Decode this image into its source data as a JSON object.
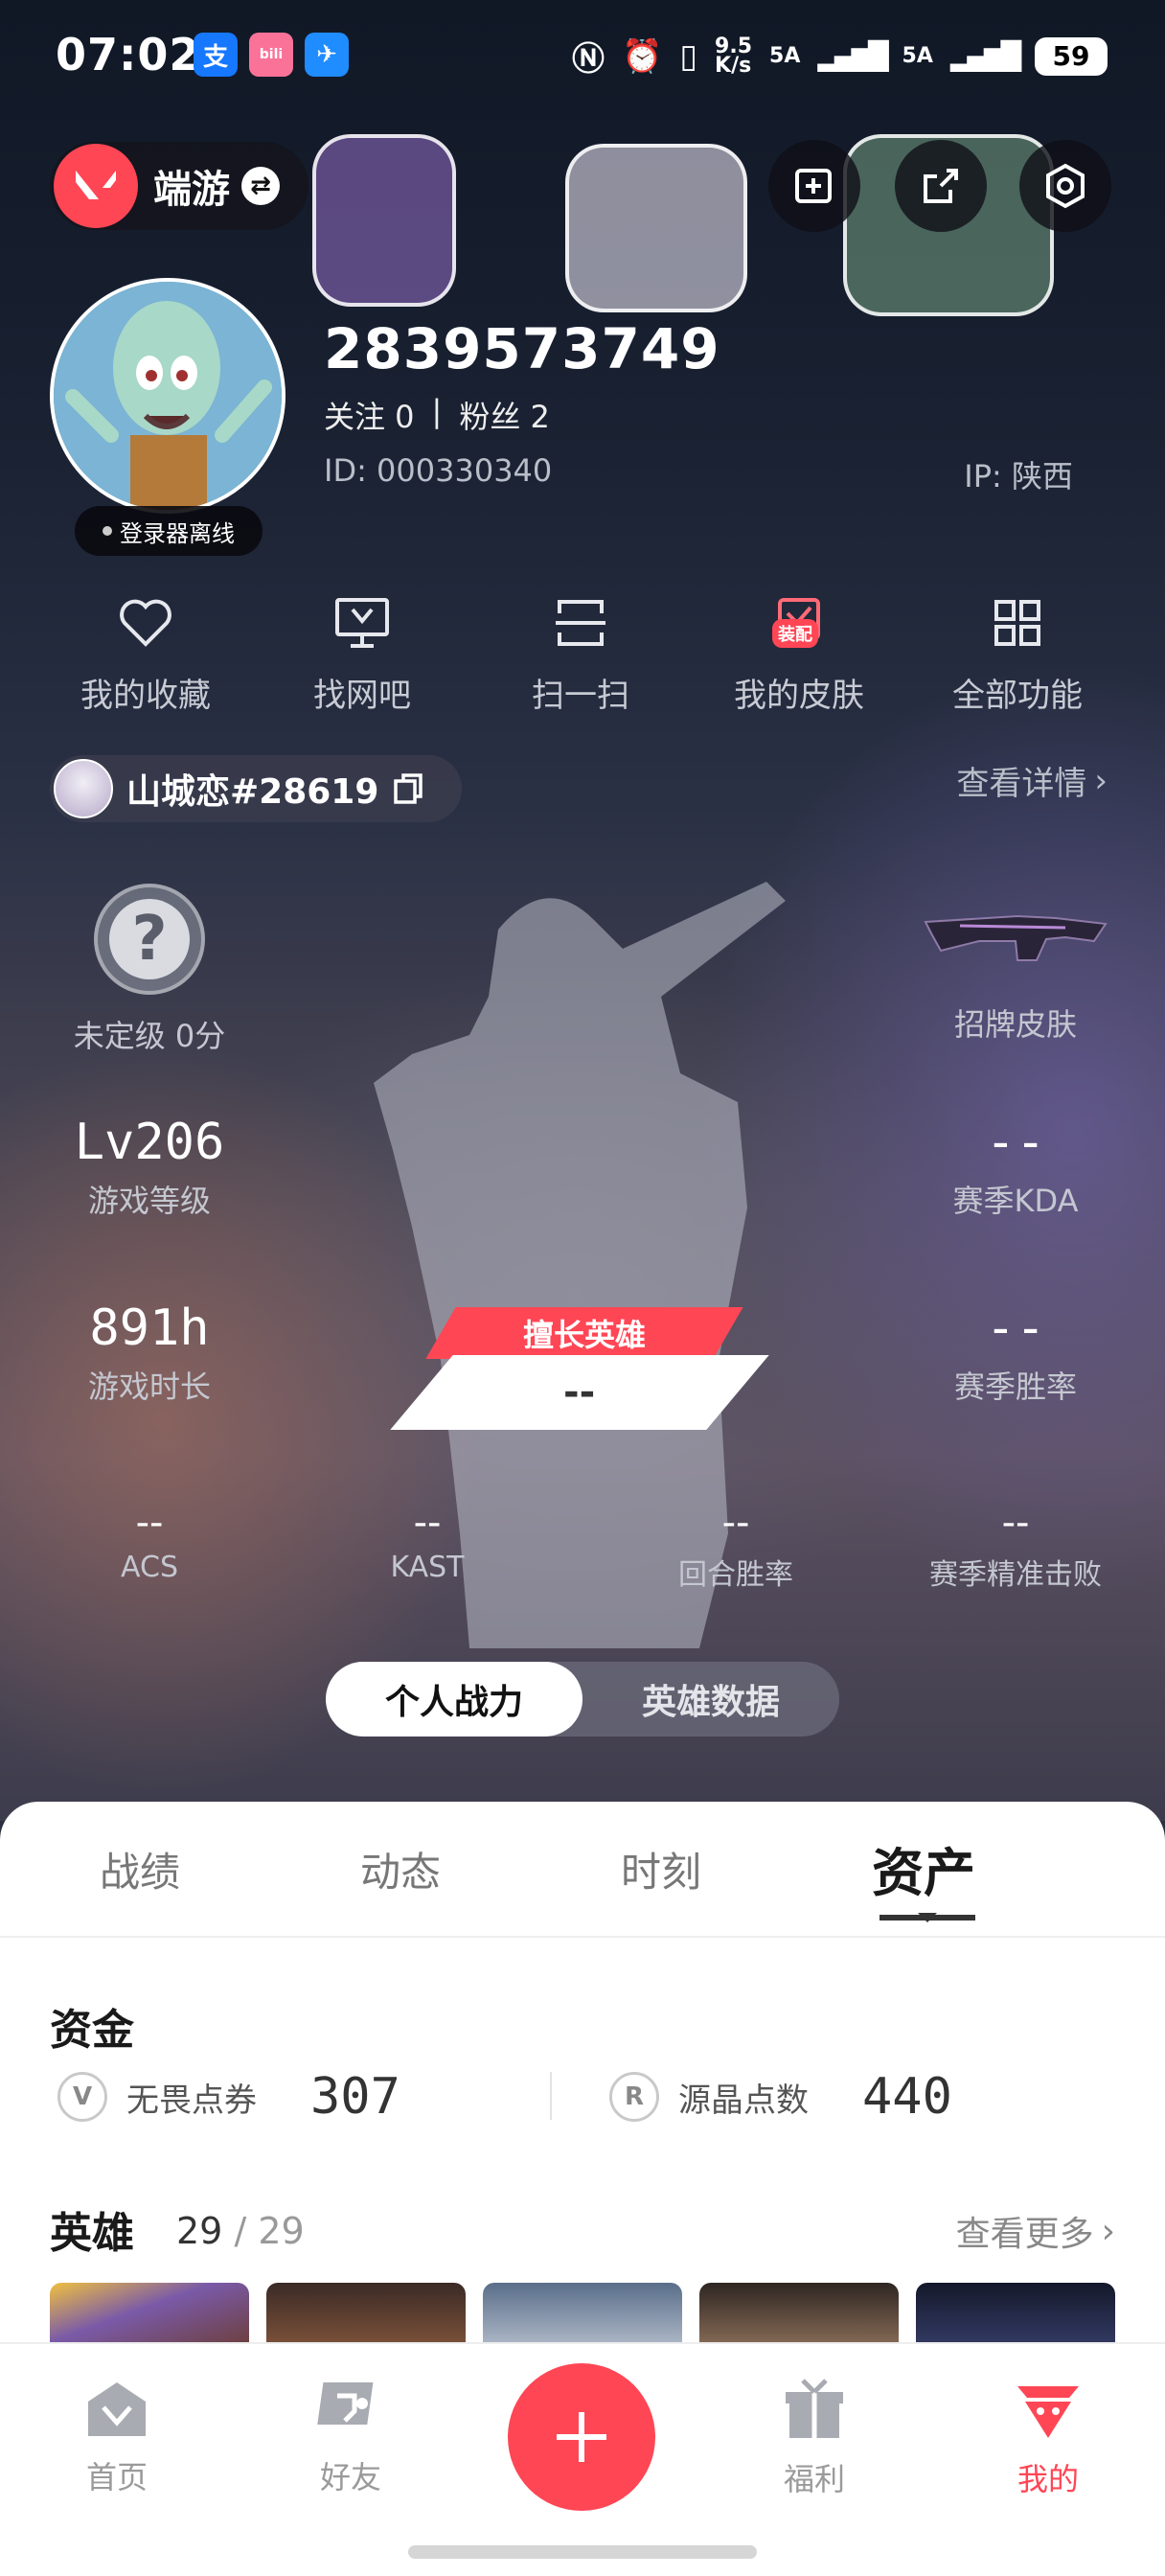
{
  "status_bar": {
    "time": "07:02",
    "app_badges": [
      "支",
      "bili",
      "✈"
    ],
    "net_speed_top": "9.5",
    "net_speed_unit": "K/s",
    "signal_1": "5A",
    "signal_2": "5A",
    "battery": "59"
  },
  "header": {
    "game_name": "端游",
    "icons": [
      "share-screen-icon",
      "share-icon",
      "settings-icon"
    ]
  },
  "profile": {
    "username": "2839573749",
    "follow_label": "关注 0",
    "fans_label": "粉丝 2",
    "separator": "|",
    "id_text": "ID:  000330340",
    "ip_text": "IP:  陕西",
    "status": "登录器离线"
  },
  "quick_actions": [
    {
      "label": "我的收藏",
      "icon": "heart-icon"
    },
    {
      "label": "找网吧",
      "icon": "monitor-icon"
    },
    {
      "label": "扫一扫",
      "icon": "scan-icon"
    },
    {
      "label": "我的皮肤",
      "icon": "skin-icon",
      "badge": "装配"
    },
    {
      "label": "全部功能",
      "icon": "grid-icon"
    }
  ],
  "riot": {
    "name": "山城恋#28619",
    "view_detail": "查看详情"
  },
  "stats": {
    "rank_label": "未定级 0分",
    "rank_symbol": "?",
    "skin_label": "招牌皮肤",
    "level_value": "Lv206",
    "level_label": "游戏等级",
    "kda_value": "--",
    "kda_label": "赛季KDA",
    "hours_value": "891h",
    "hours_label": "游戏时长",
    "winrate_value": "--",
    "winrate_label": "赛季胜率",
    "best_hero_tag": "擅长英雄",
    "best_hero_value": "--",
    "acs_value": "--",
    "acs_label": "ACS",
    "kast_value": "--",
    "kast_label": "KAST",
    "round_value": "--",
    "round_label": "回合胜率",
    "hs_value": "--",
    "hs_label": "赛季精准击败"
  },
  "segment": {
    "active": "个人战力",
    "inactive": "英雄数据"
  },
  "tabs": [
    "战绩",
    "动态",
    "时刻",
    "资产"
  ],
  "active_tab": "资产",
  "funds": {
    "title": "资金",
    "vp_label": "无畏点券",
    "vp_value": "307",
    "rp_label": "源晶点数",
    "rp_value": "440"
  },
  "heroes": {
    "title": "英雄",
    "owned": "29",
    "total": "/ 29",
    "see_more": "查看更多"
  },
  "bottom_nav": [
    {
      "label": "首页",
      "icon": "home-icon"
    },
    {
      "label": "好友",
      "icon": "friends-icon"
    },
    {
      "label": "",
      "icon": "plus-icon"
    },
    {
      "label": "福利",
      "icon": "gift-icon"
    },
    {
      "label": "我的",
      "icon": "profile-icon"
    }
  ],
  "colors": {
    "accent": "#ff4655",
    "sheet": "#ffffff"
  }
}
